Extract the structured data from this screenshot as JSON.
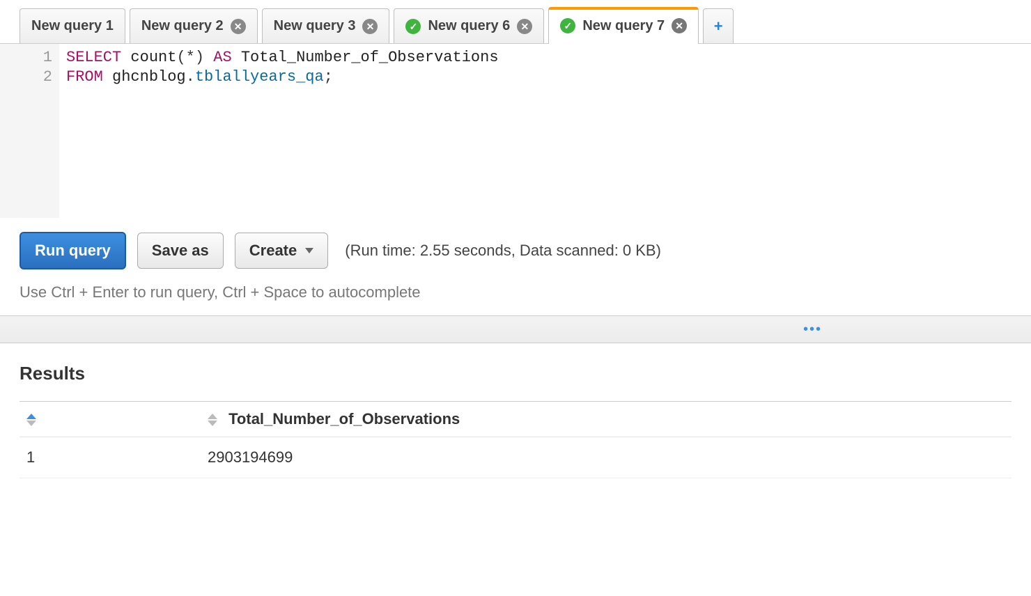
{
  "tabs": [
    {
      "label": "New query 1",
      "hasCheck": false,
      "hasClose": false,
      "active": false
    },
    {
      "label": "New query 2",
      "hasCheck": false,
      "hasClose": true,
      "active": false
    },
    {
      "label": "New query 3",
      "hasCheck": false,
      "hasClose": true,
      "active": false
    },
    {
      "label": "New query 6",
      "hasCheck": true,
      "hasClose": true,
      "active": false
    },
    {
      "label": "New query 7",
      "hasCheck": true,
      "hasClose": true,
      "active": true
    }
  ],
  "editor": {
    "line_numbers": [
      "1",
      "2"
    ],
    "tokens_line1": {
      "select": "SELECT",
      "count": "count",
      "paren_open": "(",
      "star": "*",
      "paren_close": ")",
      "as": "AS",
      "alias": "Total_Number_of_Observations"
    },
    "tokens_line2": {
      "from": "FROM",
      "db": "ghcnblog",
      "dot": ".",
      "table": "tblallyears_qa",
      "semi": ";"
    }
  },
  "toolbar": {
    "run_label": "Run query",
    "save_as_label": "Save as",
    "create_label": "Create",
    "status_text": "(Run time: 2.55 seconds, Data scanned: 0 KB)"
  },
  "hint_text": "Use Ctrl + Enter to run query, Ctrl + Space to autocomplete",
  "divider_dots": "•••",
  "results": {
    "heading": "Results",
    "columns": [
      "",
      "Total_Number_of_Observations"
    ],
    "rows": [
      {
        "rownum": "1",
        "cells": [
          "2903194699"
        ]
      }
    ]
  }
}
